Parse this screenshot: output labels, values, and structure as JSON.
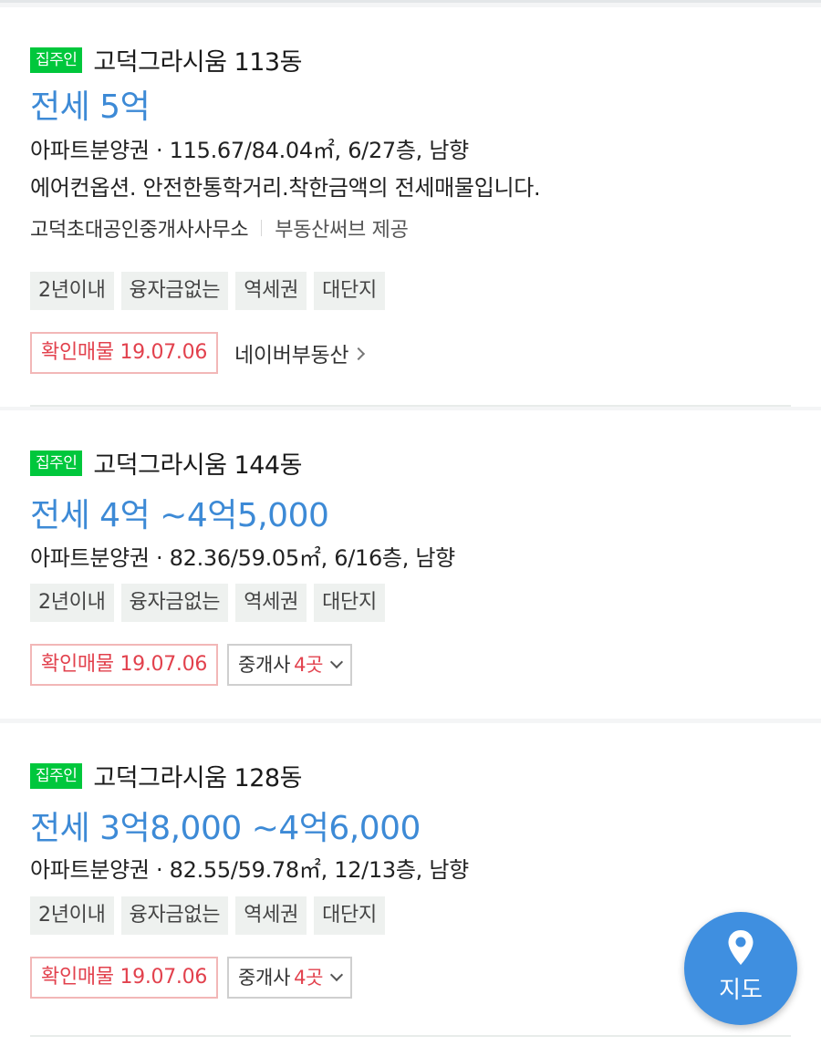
{
  "listings": [
    {
      "badge": "집주인",
      "title": "고덕그라시움 113동",
      "price": "전세 5억",
      "info": "아파트분양권 · 115.67/84.04㎡, 6/27층, 남향",
      "description": "에어컨옵션. 안전한통학거리.착한금액의 전세매물입니다.",
      "agency": "고덕초대공인중개사사무소",
      "provider": "부동산써브 제공",
      "tags": [
        "2년이내",
        "융자금없는",
        "역세권",
        "대단지"
      ],
      "verified": "확인매물 19.07.06",
      "link": "네이버부동산"
    },
    {
      "badge": "집주인",
      "title": "고덕그라시움 144동",
      "price": "전세 4억 ~4억5,000",
      "info": "아파트분양권 · 82.36/59.05㎡, 6/16층, 남향",
      "tags": [
        "2년이내",
        "융자금없는",
        "역세권",
        "대단지"
      ],
      "verified": "확인매물 19.07.06",
      "broker_label": "중개사",
      "broker_count": "4곳"
    },
    {
      "badge": "집주인",
      "title": "고덕그라시움 128동",
      "price": "전세 3억8,000 ~4억6,000",
      "info": "아파트분양권 · 82.55/59.78㎡, 12/13층, 남향",
      "tags": [
        "2년이내",
        "융자금없는",
        "역세권",
        "대단지"
      ],
      "verified": "확인매물 19.07.06",
      "broker_label": "중개사",
      "broker_count": "4곳"
    }
  ],
  "map_button": {
    "label": "지도",
    "icon": "map-pin-icon"
  },
  "colors": {
    "badge": "#00c73c",
    "price": "#3d8ad6",
    "verified": "#e2414d",
    "fab": "#3f8fe0"
  }
}
